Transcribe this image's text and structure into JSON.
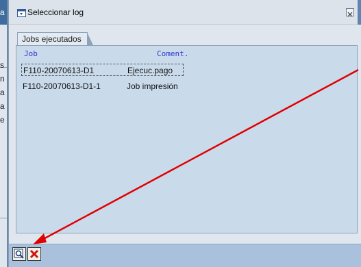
{
  "background_app": {
    "edge_letters": [
      "a",
      "s",
      "n",
      "a",
      "a",
      "e"
    ]
  },
  "dialog": {
    "title": "Seleccionar log",
    "tab_label": "Jobs ejecutados",
    "columns": {
      "job": "Job",
      "comment": "Coment."
    },
    "rows": [
      {
        "job": "F110-20070613-D1",
        "comment": "Ejecuc.pago",
        "selected": true
      },
      {
        "job": "F110-20070613-D1-1",
        "comment": "Job impresión",
        "selected": false
      }
    ]
  },
  "toolbar": {
    "buttons": [
      {
        "icon": "magnifier-view-icon"
      },
      {
        "icon": "cancel-x-icon"
      }
    ]
  },
  "colors": {
    "header_text": "#2f34d8",
    "content_bg": "#c9daea",
    "toolbar_bg": "#a9c1dc",
    "annotation_arrow": "#e00000",
    "cancel_icon": "#d01010"
  }
}
